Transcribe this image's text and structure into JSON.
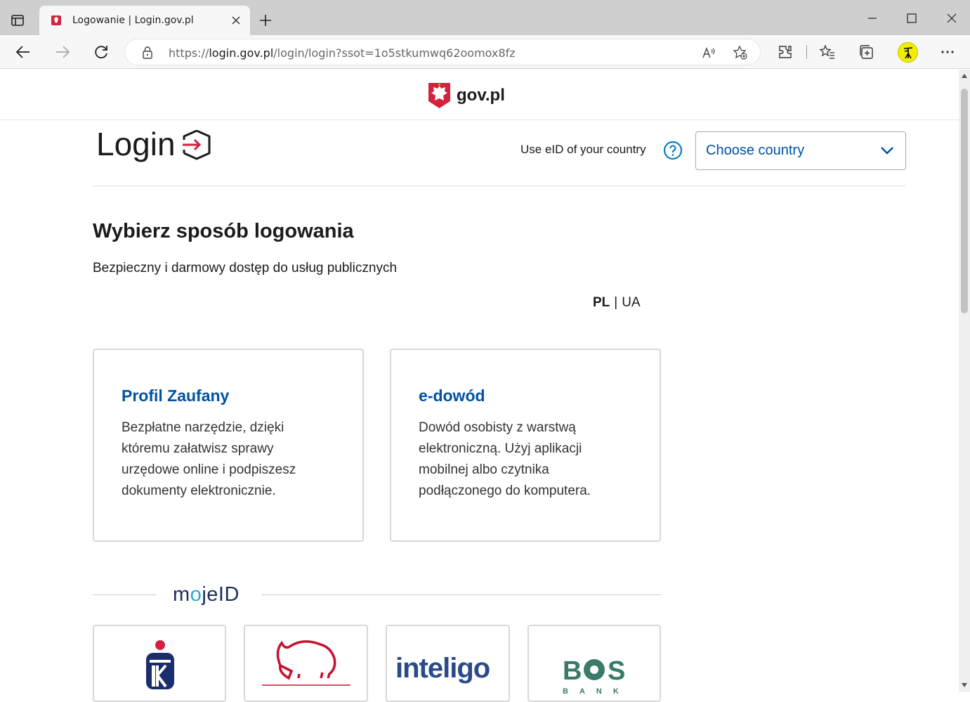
{
  "browser": {
    "tab_title": "Logowanie | Login.gov.pl",
    "url_scheme": "https://",
    "url_host": "login.gov.pl",
    "url_path": "/login/login?ssot=1o5stkumwq62oomox8fz"
  },
  "header": {
    "logo_text": "gov.pl"
  },
  "login": {
    "title": "Login",
    "eid_label": "Use eID of your country",
    "country_select_value": "Choose country"
  },
  "main": {
    "heading": "Wybierz sposób logowania",
    "subtitle": "Bezpieczny i darmowy dostęp do usług publicznych",
    "lang_pl": "PL",
    "lang_sep": "|",
    "lang_ua": "UA",
    "cards": [
      {
        "title": "Profil Zaufany",
        "description": "Bezpłatne narzędzie, dzięki któremu załatwisz sprawy urzędowe online i podpiszesz dokumenty elektronicznie."
      },
      {
        "title": "e-dowód",
        "description": "Dowód osobisty z warstwą elektroniczną. Użyj aplikacji mobilnej albo czytnika podłączonego do komputera."
      }
    ]
  },
  "mojeid": {
    "logo_part1": "m",
    "logo_part2": "o",
    "logo_part3": "jeID",
    "banks": [
      {
        "name": "pko-bank",
        "text": ""
      },
      {
        "name": "pekao-bank",
        "text": ""
      },
      {
        "name": "inteligo-bank",
        "text": "inteligo"
      },
      {
        "name": "bos-bank",
        "text": "BOŚ"
      }
    ]
  },
  "colors": {
    "link_blue": "#0052a5",
    "text_dark": "#1b1b1b",
    "card_border": "#d8d8d8"
  }
}
